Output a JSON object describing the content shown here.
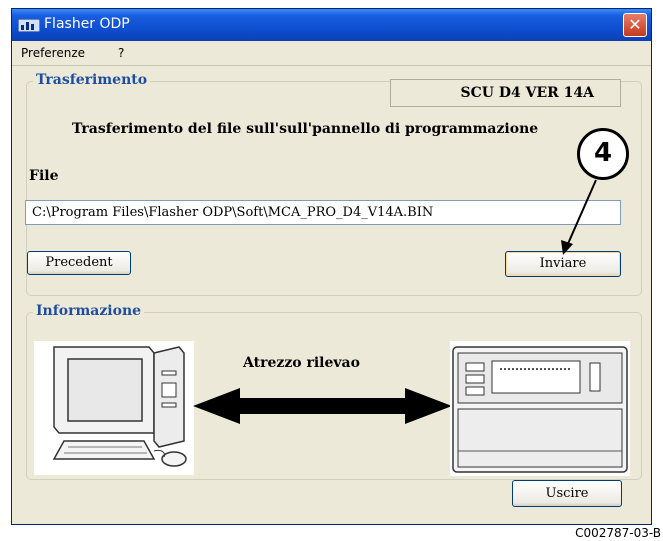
{
  "window": {
    "title": "Flasher ODP"
  },
  "menu": {
    "items": [
      "Preferenze",
      "?"
    ]
  },
  "transfer": {
    "group_title": "Trasferimento",
    "version": "SCU D4 VER  14A",
    "subtitle": "Trasferimento del file sull'sull'pannello di programmazione",
    "file_label": "File",
    "file_path": "C:\\Program Files\\Flasher ODP\\Soft\\MCA_PRO_D4_V14A.BIN",
    "prev_button": "Precedent",
    "send_button": "Inviare"
  },
  "info": {
    "group_title": "Informazione",
    "detect_label": "Atrezzo rilevao"
  },
  "exit_button": "Uscire",
  "annotation": {
    "step_number": "4"
  },
  "reference_code": "C002787-03-B"
}
